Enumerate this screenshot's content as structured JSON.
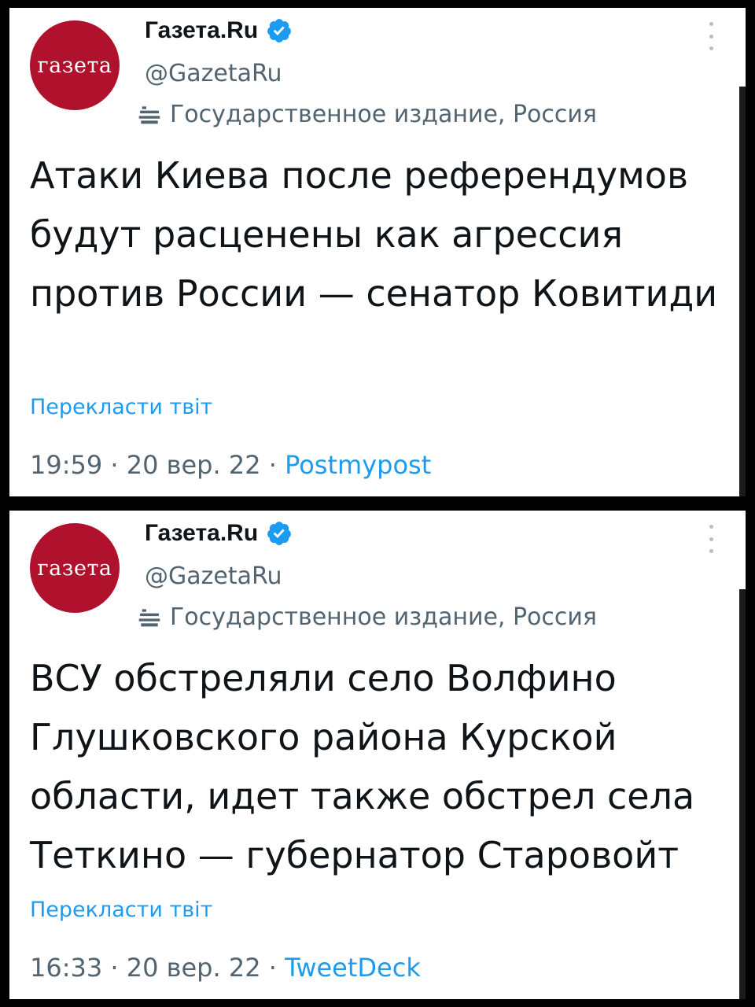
{
  "colors": {
    "avatar_bg": "#b0122d",
    "verified": "#1d9bf0",
    "link": "#1d9bf0",
    "secondary_text": "#536471",
    "primary_text": "#0f1419"
  },
  "tweets": [
    {
      "avatar_text": "газета",
      "display_name": "Газета.Ru",
      "handle": "@GazetaRu",
      "account_label": "Государственное издание, Россия",
      "text": "Атаки Киева после референдумов будут расценены как агрессия против России — сенатор Ковитиди",
      "translate_label": "Перекласти твіт",
      "time": "19:59",
      "date": "20 вер. 22",
      "source": "Postmypost",
      "separator": "·"
    },
    {
      "avatar_text": "газета",
      "display_name": "Газета.Ru",
      "handle": "@GazetaRu",
      "account_label": "Государственное издание, Россия",
      "text": "ВСУ обстреляли село Волфино Глушковского района Курской области, идет также обстрел села Теткино — губернатор Старовойт",
      "translate_label": "Перекласти твіт",
      "time": "16:33",
      "date": "20 вер. 22",
      "source": "TweetDeck",
      "separator": "·"
    }
  ]
}
